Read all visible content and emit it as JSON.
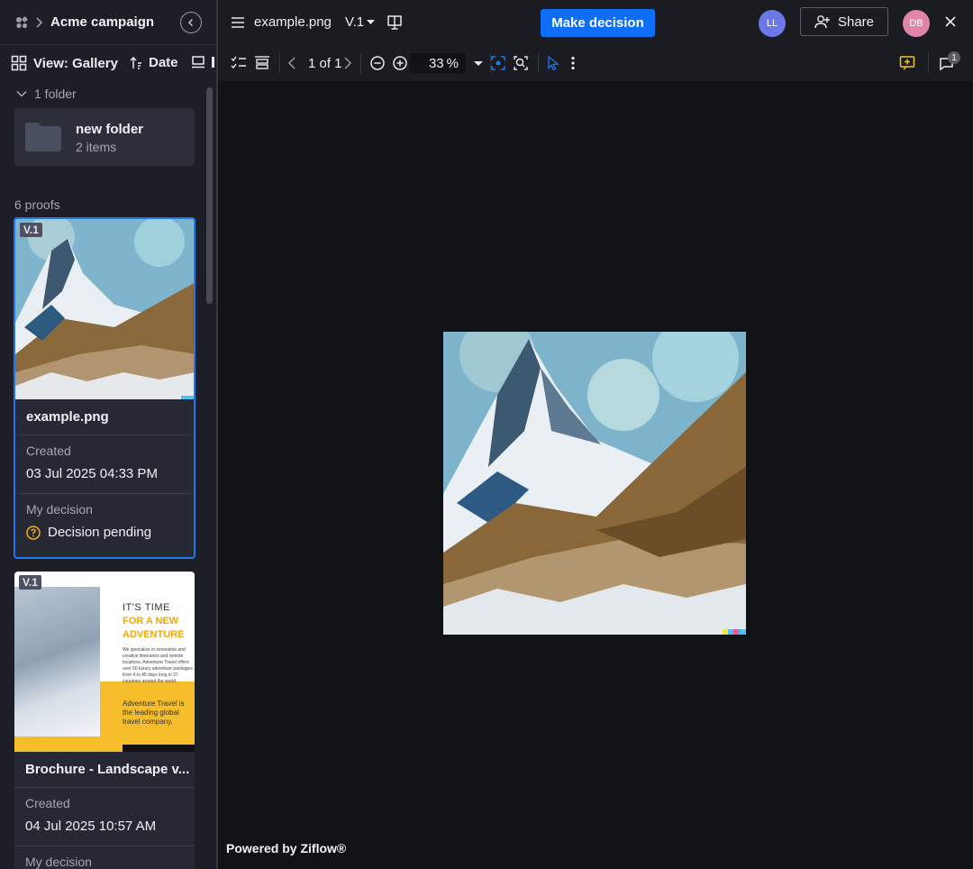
{
  "project": {
    "title": "Acme campaign"
  },
  "sidebar": {
    "view_label": "View: Gallery",
    "sort_label": "Date",
    "folders_toggle": "1 folder",
    "folder": {
      "name": "new folder",
      "count": "2 items"
    },
    "proofs_count": "6 proofs",
    "proofs": [
      {
        "version": "V.1",
        "name": "example.png",
        "created_label": "Created",
        "created_value": "03 Jul 2025 04:33 PM",
        "decision_label": "My decision",
        "decision_value": "Decision pending"
      },
      {
        "version": "V.1",
        "name": "Brochure - Landscape v...",
        "created_label": "Created",
        "created_value": "04 Jul 2025 10:57 AM",
        "decision_label": "My decision",
        "thumb_text": {
          "line1": "IT'S TIME",
          "line2": "FOR A NEW",
          "line3": "ADVENTURE",
          "body": "We specialize in innovative and creative itineraries and remote locations. Adventure Travel offers over 50 luxury adventure packages from 4 to 45 days long in 27 countries around the world.",
          "tagline": "Adventure Travel is the leading global travel company."
        }
      }
    ]
  },
  "topbar": {
    "file_name": "example.png",
    "version": "V.1",
    "make_decision": "Make decision",
    "share": "Share",
    "avatar_1": "LL",
    "avatar_2": "DB"
  },
  "viewer": {
    "page_count": "1 of 1",
    "zoom": "33",
    "zoom_unit": "%",
    "comment_count": "1"
  },
  "footer": {
    "powered_by": "Powered by Ziflow®"
  },
  "colors": {
    "accent": "#0e6ef5",
    "pending": "#f2b01e",
    "add_comment": "#f2c12e"
  }
}
